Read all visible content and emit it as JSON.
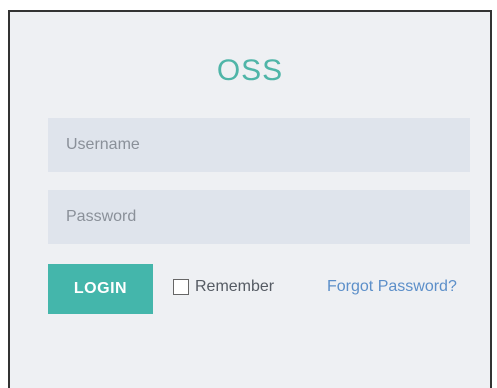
{
  "login_form": {
    "title": "OSS",
    "username_placeholder": "Username",
    "password_placeholder": "Password",
    "login_label": "LOGIN",
    "remember_label": "Remember",
    "remember_checked": false,
    "forgot_label": "Forgot Password?"
  },
  "colors": {
    "accent": "#44b6ab",
    "title": "#4fb5a8",
    "link": "#5c8fc9",
    "field_background": "#dfe4ec",
    "panel_background": "#eef0f3"
  }
}
